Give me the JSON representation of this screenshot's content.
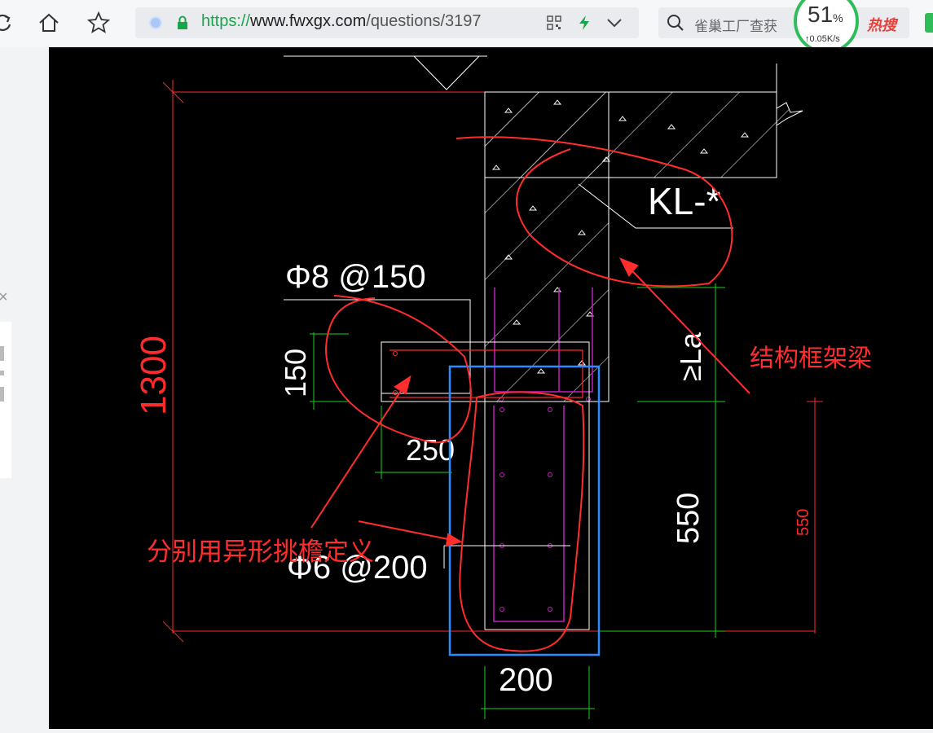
{
  "browser": {
    "address": {
      "protocol": "https://",
      "host": "www.fwxgx.com",
      "path": "/questions/3197"
    },
    "search": {
      "text": "雀巢工厂查获"
    },
    "hot_label": "热搜",
    "speed": {
      "percent": "51",
      "percent_sign": "%",
      "rate": "0.05K/s"
    },
    "icons": [
      "reload-icon",
      "home-icon",
      "star-icon",
      "security-icon",
      "lock-icon",
      "qr-icon",
      "lightning-icon",
      "chevron-down-icon",
      "search-icon",
      "close-icon"
    ],
    "accent_color": "#1aa54b"
  },
  "drawing": {
    "dimensions": {
      "height_total": "1300",
      "rebar_top": "Φ8 @150",
      "dim_150": "150",
      "dim_250": "250",
      "rebar_bottom": "Φ6 @200",
      "dim_200": "200",
      "dim_550_white": "550",
      "dim_550_red": "550",
      "la_mark": "≥La"
    },
    "beam_label": "KL-*",
    "annotations": {
      "frame_beam": "结构框架梁",
      "eave_note": "分别用异形挑檐定义"
    },
    "colors": {
      "background": "#000000",
      "lines": "#ffffff",
      "dimension_green": "#1bd01b",
      "dimension_red": "#ff2a2a",
      "rebar_magenta": "#c020c0",
      "markup_red": "#ff2d2d",
      "highlight_blue": "#2a8cff"
    }
  }
}
